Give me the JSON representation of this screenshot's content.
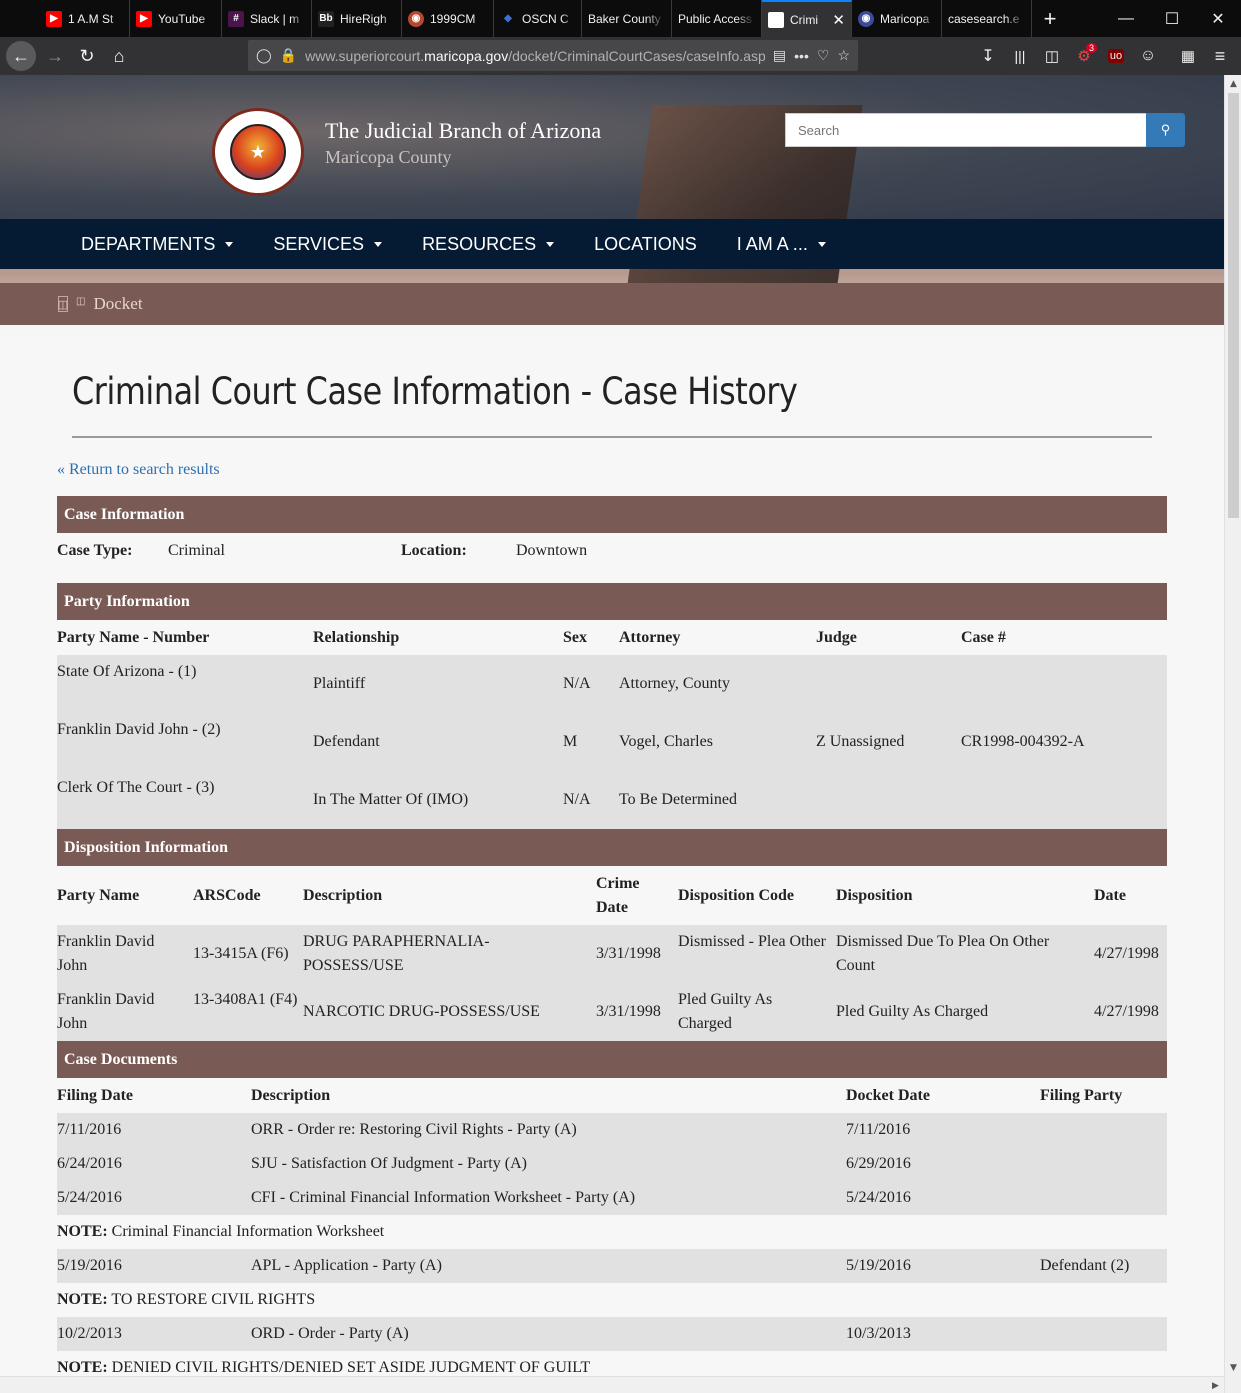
{
  "browser": {
    "tabs": [
      {
        "title": "1 A.M St",
        "favicon": "youtube-icon",
        "color": "#ff0000"
      },
      {
        "title": "YouTube",
        "favicon": "youtube-icon",
        "color": "#ff0000"
      },
      {
        "title": "Slack | m",
        "favicon": "slack-icon",
        "color": "#4a154b"
      },
      {
        "title": "HireRigh",
        "favicon": "bb-icon",
        "color": "#222222"
      },
      {
        "title": "1999CM",
        "favicon": "seal-icon",
        "color": "#b5482f"
      },
      {
        "title": "OSCN C",
        "favicon": "shield-icon",
        "color": "#3b6fd1"
      },
      {
        "title": "Baker County",
        "favicon": "",
        "color": ""
      },
      {
        "title": "Public Access",
        "favicon": "",
        "color": ""
      },
      {
        "title": "Crimi",
        "favicon": "page-icon",
        "color": "#ffffff",
        "active": true
      },
      {
        "title": "Maricopa",
        "favicon": "seal-icon",
        "color": "#3b4b9a"
      },
      {
        "title": "casesearch.e",
        "favicon": "",
        "color": ""
      }
    ],
    "url_host": "www.superiorcourt.",
    "url_domain": "maricopa.gov",
    "url_path": "/docket/CriminalCourtCases/caseInfo.asp",
    "addon_badge": "3"
  },
  "header": {
    "title": "The Judicial Branch of Arizona",
    "subtitle": "Maricopa County",
    "search_placeholder": "Search"
  },
  "nav": {
    "items": [
      "DEPARTMENTS",
      "SERVICES",
      "RESOURCES",
      "LOCATIONS",
      "I AM A ..."
    ],
    "has_caret": [
      true,
      true,
      true,
      false,
      true
    ]
  },
  "breadcrumb": {
    "label": "Docket"
  },
  "main": {
    "heading": "Criminal Court Case Information - Case History",
    "return_link": "« Return to search results"
  },
  "case_info": {
    "section_title": "Case Information",
    "case_type_label": "Case Type:",
    "case_type": "Criminal",
    "location_label": "Location:",
    "location": "Downtown"
  },
  "party_info": {
    "section_title": "Party Information",
    "headers": [
      "Party Name - Number",
      "Relationship",
      "Sex",
      "Attorney",
      "Judge",
      "Case #"
    ],
    "rows": [
      [
        "State Of Arizona - (1)",
        "Plaintiff",
        "N/A",
        "Attorney, County",
        "",
        ""
      ],
      [
        "Franklin David John - (2)",
        "Defendant",
        "M",
        "Vogel, Charles",
        "Z Unassigned",
        "CR1998-004392-A"
      ],
      [
        "Clerk Of The Court - (3)",
        "In The Matter Of (IMO)",
        "N/A",
        "To Be Determined",
        "",
        ""
      ]
    ]
  },
  "disposition": {
    "section_title": "Disposition Information",
    "headers": [
      "Party Name",
      "ARSCode",
      "Description",
      "Crime Date",
      "Disposition Code",
      "Disposition",
      "Date"
    ],
    "rows": [
      [
        "Franklin David John",
        "13-3415A (F6)",
        "DRUG PARAPHERNALIA-POSSESS/USE",
        "3/31/1998",
        "Dismissed - Plea Other",
        "Dismissed Due To Plea On Other Count",
        "4/27/1998"
      ],
      [
        "Franklin David John",
        "13-3408A1 (F4)",
        "NARCOTIC DRUG-POSSESS/USE",
        "3/31/1998",
        "Pled Guilty As Charged",
        "Pled Guilty As Charged",
        "4/27/1998"
      ]
    ]
  },
  "documents": {
    "section_title": "Case Documents",
    "headers": [
      "Filing Date",
      "Description",
      "Docket Date",
      "Filing Party"
    ],
    "note_label": "NOTE:",
    "rows": [
      {
        "filing_date": "7/11/2016",
        "description": "ORR - Order re: Restoring Civil Rights - Party (A)",
        "docket_date": "7/11/2016",
        "filing_party": ""
      },
      {
        "filing_date": "6/24/2016",
        "description": "SJU - Satisfaction Of Judgment - Party (A)",
        "docket_date": "6/29/2016",
        "filing_party": ""
      },
      {
        "filing_date": "5/24/2016",
        "description": "CFI - Criminal Financial Information Worksheet - Party (A)",
        "docket_date": "5/24/2016",
        "filing_party": ""
      },
      {
        "note": "Criminal Financial Information Worksheet"
      },
      {
        "filing_date": "5/19/2016",
        "description": "APL - Application - Party (A)",
        "docket_date": "5/19/2016",
        "filing_party": "Defendant (2)"
      },
      {
        "note": "TO RESTORE CIVIL RIGHTS"
      },
      {
        "filing_date": "10/2/2013",
        "description": "ORD - Order - Party (A)",
        "docket_date": "10/3/2013",
        "filing_party": ""
      },
      {
        "note": "DENIED CIVIL RIGHTS/DENIED SET ASIDE JUDGMENT OF GUILT"
      }
    ]
  },
  "colors": {
    "section_bar": "#7a5a54",
    "nav": "#051b33",
    "link": "#2f6fb0",
    "row_stripe": "#e1e1e1",
    "search_button": "#337ab7"
  }
}
